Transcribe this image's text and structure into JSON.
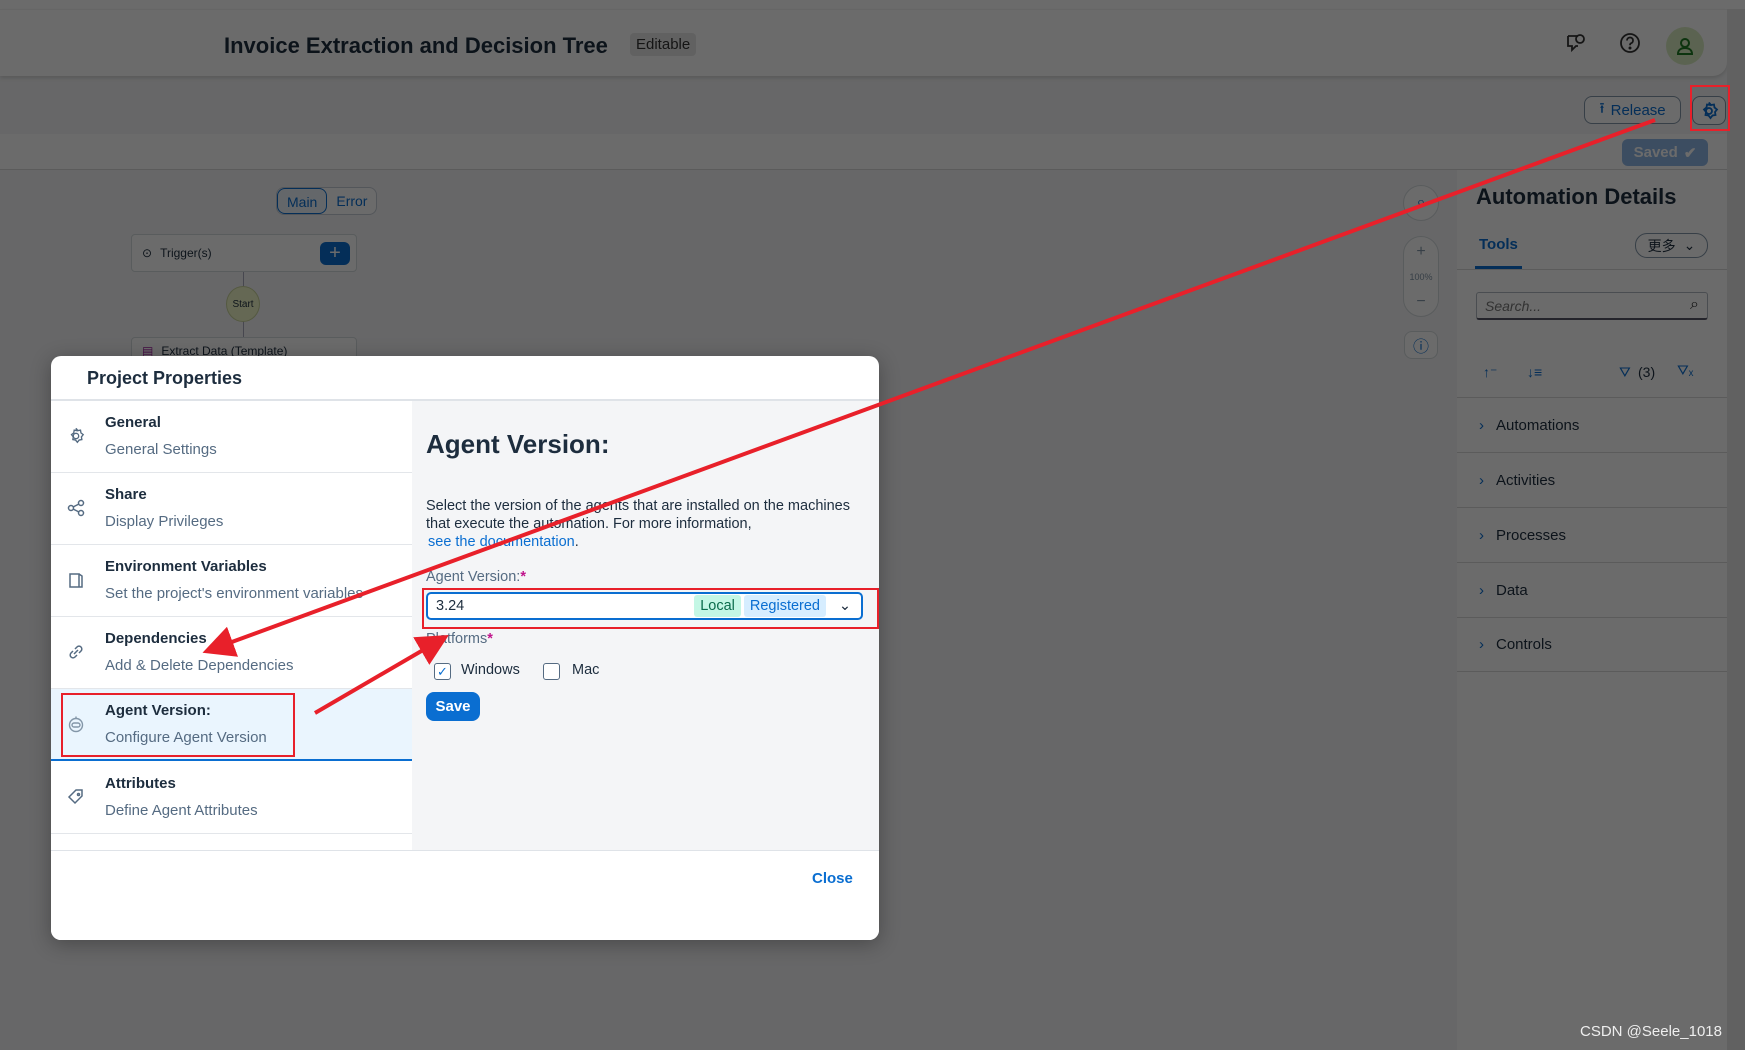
{
  "header": {
    "title": "Invoice Extraction and Decision Tree",
    "badge": "Editable",
    "icons": [
      "feedback-icon",
      "help-icon",
      "user-avatar-icon"
    ]
  },
  "toolbar": {
    "release_label": "Release",
    "settings_icon": "gear-icon",
    "saved_label": "Saved"
  },
  "canvas": {
    "tabs": [
      "Main",
      "Error"
    ],
    "active_tab": "Main",
    "trigger_label": "Trigger(s)",
    "start_label": "Start",
    "step_label": "Extract Data (Template)",
    "zoom_level": "100%"
  },
  "right_panel": {
    "title": "Automation Details",
    "tab": "Tools",
    "more_label": "更多",
    "search_placeholder": "Search...",
    "filter_count": "(3)",
    "items": [
      "Automations",
      "Activities",
      "Processes",
      "Data",
      "Controls"
    ]
  },
  "dialog": {
    "title": "Project Properties",
    "nav": [
      {
        "title": "General",
        "subtitle": "General Settings",
        "icon": "gear-icon"
      },
      {
        "title": "Share",
        "subtitle": "Display Privileges",
        "icon": "share-icon"
      },
      {
        "title": "Environment Variables",
        "subtitle": "Set the project's environment variables",
        "icon": "copy-icon"
      },
      {
        "title": "Dependencies",
        "subtitle": "Add & Delete Dependencies",
        "icon": "link-icon"
      },
      {
        "title": "Agent Version:",
        "subtitle": "Configure Agent Version",
        "icon": "robot-icon",
        "selected": true
      },
      {
        "title": "Attributes",
        "subtitle": "Define Agent Attributes",
        "icon": "tag-icon"
      }
    ],
    "content": {
      "title": "Agent Version:",
      "description": "Select the version of the agents that are installed on the machines that execute the automation. For more information,",
      "link": "see the documentation",
      "link_suffix": ".",
      "version_label": "Agent Version:",
      "required_mark": "*",
      "version_value": "3.24",
      "tag_local": "Local",
      "tag_registered": "Registered",
      "platforms_label": "Platforms",
      "platforms": [
        {
          "label": "Windows",
          "checked": true
        },
        {
          "label": "Mac",
          "checked": false
        }
      ],
      "save_label": "Save"
    },
    "close_label": "Close"
  },
  "watermark": "CSDN @Seele_1018",
  "colors": {
    "accent": "#0a6ed1",
    "annotation": "#e8202a",
    "required": "#c0148c"
  }
}
